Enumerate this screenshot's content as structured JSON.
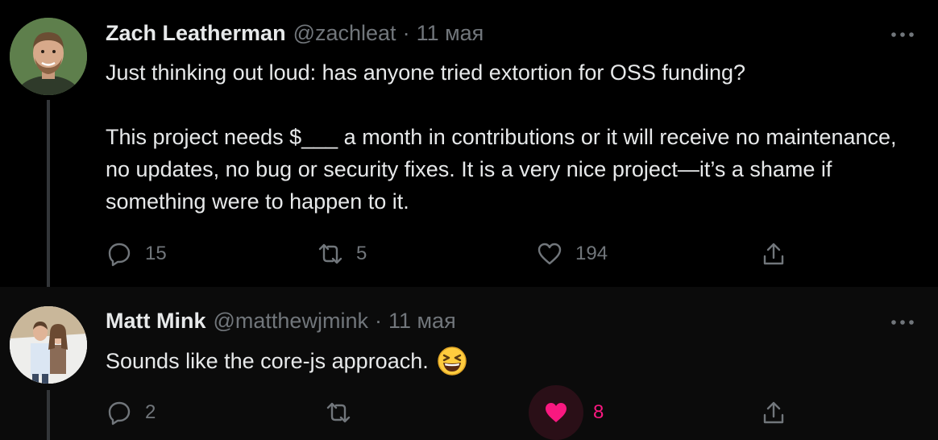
{
  "tweets": [
    {
      "author_name": "Zach Leatherman",
      "handle": "@zachleat",
      "separator": "·",
      "time": "11 мая",
      "paragraphs": [
        "Just thinking out loud: has anyone tried extortion for OSS funding?",
        "This project needs $___ a month in contributions or it will receive no maintenance, no updates, no bug or security fixes. It is a very nice project—it’s a shame if something were to happen to it."
      ],
      "actions": {
        "replies": "15",
        "retweets": "5",
        "likes": "194"
      },
      "avatar_icon": "person-avatar-icon"
    },
    {
      "author_name": "Matt Mink",
      "handle": "@matthewjmink",
      "separator": "·",
      "time": "11 мая",
      "text": "Sounds like the core-js approach.",
      "emoji": "grinning-squinting-face-icon",
      "actions": {
        "replies": "2",
        "retweets": "",
        "likes": "8"
      },
      "liked": true,
      "avatar_icon": "couple-avatar-icon"
    }
  ],
  "colors": {
    "background": "#000000",
    "reply_background": "#0b0b0b",
    "text": "#e7e9ea",
    "muted": "#71767b",
    "like_pink": "#f91880",
    "thread_line": "#333639"
  }
}
